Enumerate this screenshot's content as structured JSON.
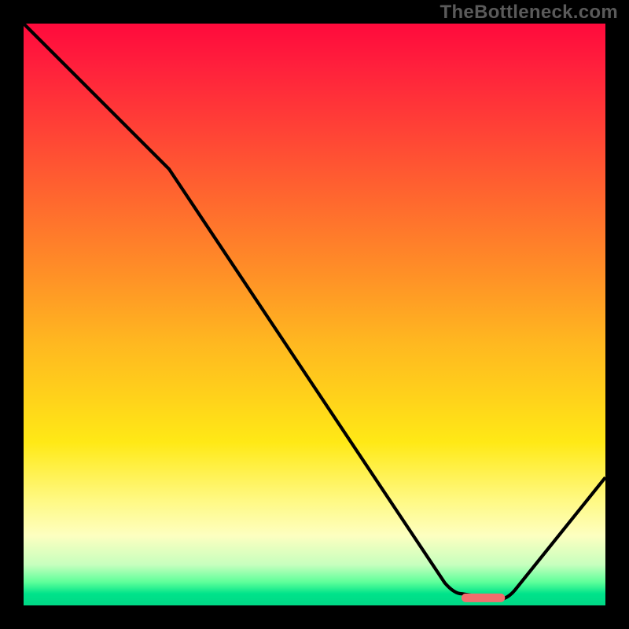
{
  "watermark": "TheBottleneck.com",
  "chart_data": {
    "type": "line",
    "title": "",
    "xlabel": "",
    "ylabel": "",
    "xlim": [
      0,
      100
    ],
    "ylim": [
      0,
      100
    ],
    "grid": false,
    "annotations": [],
    "series": [
      {
        "name": "bottleneck-curve",
        "x": [
          0,
          25,
          74,
          78,
          82,
          100
        ],
        "y": [
          100,
          75,
          2,
          1,
          1,
          22
        ],
        "color": "#000000"
      },
      {
        "name": "optimal-marker",
        "x": [
          76,
          82
        ],
        "y": [
          1.3,
          1.3
        ],
        "color": "#f26d6d",
        "stroke_width_px": 11,
        "linecap": "round"
      }
    ]
  }
}
